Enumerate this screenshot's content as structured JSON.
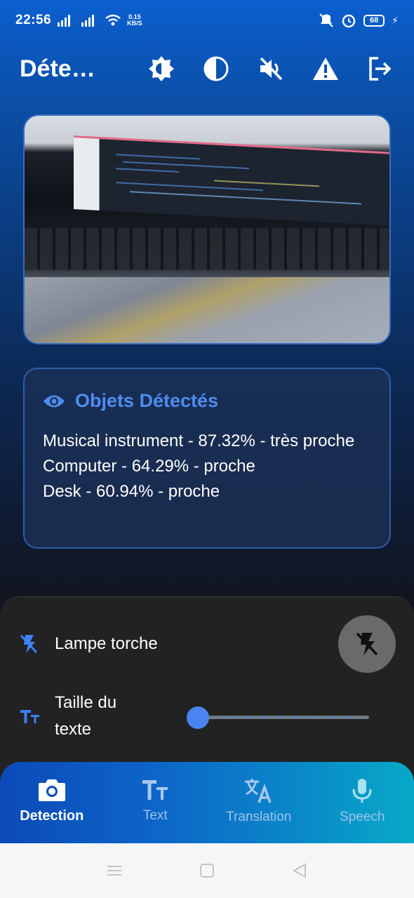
{
  "status_bar": {
    "time": "22:56",
    "net_speed_value": "0.15",
    "net_speed_unit": "KB/S",
    "battery": "68"
  },
  "app_bar": {
    "title": "Déte…",
    "actions": [
      "brightness-icon",
      "contrast-icon",
      "volume-off-icon",
      "warning-icon",
      "logout-icon"
    ]
  },
  "detections": {
    "title": "Objets Détectés",
    "items": [
      "Musical instrument - 87.32% - très proche",
      "Computer - 64.29% - proche",
      "Desk - 60.94% - proche"
    ]
  },
  "settings": {
    "torch_label": "Lampe torche",
    "text_size_label": "Taille du texte",
    "text_size_value": 0
  },
  "bottom_nav": {
    "items": [
      {
        "label": "Detection",
        "icon": "camera-icon",
        "active": true
      },
      {
        "label": "Text",
        "icon": "text-size-icon",
        "active": false
      },
      {
        "label": "Translation",
        "icon": "translate-icon",
        "active": false
      },
      {
        "label": "Speech",
        "icon": "mic-icon",
        "active": false
      }
    ]
  },
  "colors": {
    "accent": "#4f8cf0",
    "panel": "#222222",
    "card": "#1b2f55"
  }
}
